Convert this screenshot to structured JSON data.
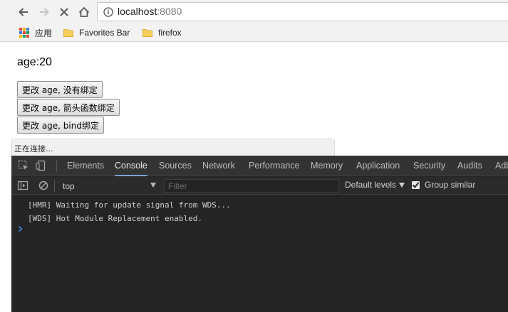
{
  "browser": {
    "url_host": "localhost",
    "url_port": ":8080",
    "bookmarks": [
      {
        "label": "应用",
        "icon": "apps-icon"
      },
      {
        "label": "Favorites Bar",
        "icon": "folder-icon"
      },
      {
        "label": "firefox",
        "icon": "folder-icon"
      }
    ],
    "status_text": "正在连接..."
  },
  "page": {
    "age_label": "age:",
    "age_value": "20",
    "buttons": [
      {
        "label": "更改 age, 没有绑定"
      },
      {
        "label": "更改 age, 箭头函数绑定"
      },
      {
        "label": "更改 age, bind绑定"
      }
    ]
  },
  "devtools": {
    "tabs": [
      "Elements",
      "Console",
      "Sources",
      "Network",
      "Performance",
      "Memory",
      "Application",
      "Security",
      "Audits",
      "Adb"
    ],
    "active_tab": "Console",
    "context": "top",
    "filter_placeholder": "Filter",
    "levels_label": "Default levels",
    "group_similar_label": "Group similar",
    "group_similar_checked": true,
    "messages": [
      "[HMR] Waiting for update signal from WDS...",
      "[WDS] Hot Module Replacement enabled."
    ]
  },
  "colors": {
    "devtools_bg": "#242424",
    "active_tab_underline": "#7aa2d8",
    "prompt": "#3c8ce6",
    "folder": "#f7cf5f"
  }
}
